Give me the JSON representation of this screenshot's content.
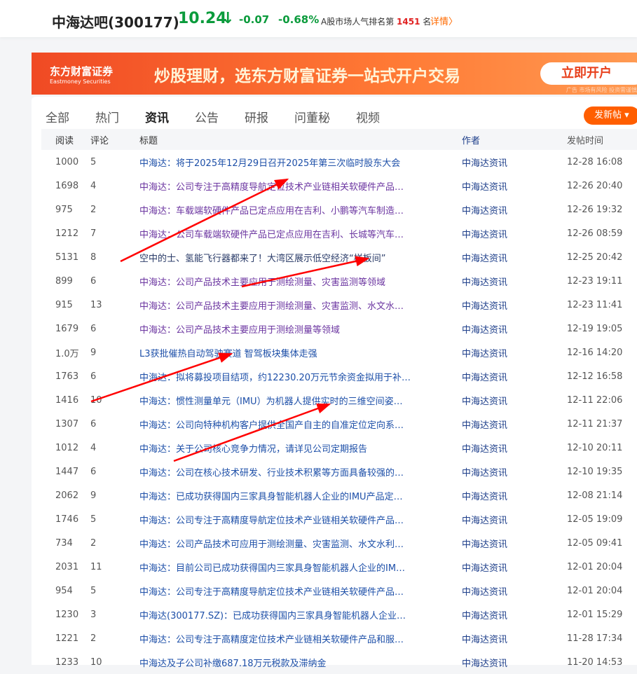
{
  "header": {
    "name": "中海达吧(300177)",
    "price": "10.24",
    "arrow": "↓",
    "change": "-0.07",
    "pct": "-0.68%",
    "rank_prefix": "A股市场人气排名第",
    "rank": "1451",
    "rank_suffix": "名",
    "detail": "详情〉"
  },
  "banner": {
    "logo": "东方财富证券",
    "logo_en": "Eastmoney Securities",
    "slogan": "炒股理财，选东方财富证券一站式开户交易",
    "cta": "立即开户",
    "ad": "广告 市场有风险 投资需谨慎"
  },
  "tabs": [
    "全部",
    "热门",
    "资讯",
    "公告",
    "研报",
    "问董秘",
    "视频"
  ],
  "active_tab": "资讯",
  "post_button": "发新帖 ▾",
  "columns": [
    "阅读",
    "评论",
    "标题",
    "作者",
    "发帖时间"
  ],
  "rows": [
    [
      "1000",
      "5",
      "中海达：将于2025年12月29日召开2025年第三次临时股东大会",
      "中海达资讯",
      "12-28 16:08",
      ""
    ],
    [
      "1698",
      "4",
      "中海达：公司专注于高精度导航定位技术产业链相关软硬件产品…",
      "中海达资讯",
      "12-26 20:40",
      "visited"
    ],
    [
      "975",
      "2",
      "中海达：车载端软硬件产品已定点应用在吉利、小鹏等汽车制造…",
      "中海达资讯",
      "12-26 19:32",
      "visited"
    ],
    [
      "1212",
      "7",
      "中海达：公司车载端软硬件产品已定点应用在吉利、长城等汽车…",
      "中海达资讯",
      "12-26 08:59",
      "visited"
    ],
    [
      "5131",
      "8",
      "空中的士、氢能飞行器都来了！大湾区展示低空经济“样板间”",
      "中海达资讯",
      "12-25 20:42",
      "plain"
    ],
    [
      "899",
      "6",
      "中海达：公司产品技术主要应用于测绘测量、灾害监测等领域",
      "中海达资讯",
      "12-23 19:11",
      "visited"
    ],
    [
      "915",
      "13",
      "中海达：公司产品技术主要应用于测绘测量、灾害监测、水文水…",
      "中海达资讯",
      "12-23 11:41",
      "visited"
    ],
    [
      "1679",
      "6",
      "中海达：公司产品技术主要应用于测绘测量等领域",
      "中海达资讯",
      "12-19 19:05",
      "visited"
    ],
    [
      "1.0万",
      "9",
      "L3获批催热自动驾驶赛道 智驾板块集体走强",
      "中海达资讯",
      "12-16 14:20",
      ""
    ],
    [
      "1763",
      "6",
      "中海达：拟将募投项目结项，约12230.20万元节余资金拟用于补…",
      "中海达资讯",
      "12-12 16:58",
      ""
    ],
    [
      "1416",
      "10",
      "中海达：惯性测量单元（IMU）为机器人提供实时的三维空间姿…",
      "中海达资讯",
      "12-11 22:06",
      ""
    ],
    [
      "1307",
      "6",
      "中海达：公司向特种机构客户提供全国产自主的自准定位定向系…",
      "中海达资讯",
      "12-11 21:37",
      ""
    ],
    [
      "1012",
      "4",
      "中海达：关于公司核心竞争力情况，请详见公司定期报告",
      "中海达资讯",
      "12-10 20:11",
      ""
    ],
    [
      "1447",
      "6",
      "中海达：公司在核心技术研发、行业技术积累等方面具备较强的…",
      "中海达资讯",
      "12-10 19:35",
      ""
    ],
    [
      "2062",
      "9",
      "中海达：已成功获得国内三家具身智能机器人企业的IMU产品定…",
      "中海达资讯",
      "12-08 21:14",
      ""
    ],
    [
      "1746",
      "5",
      "中海达：公司专注于高精度导航定位技术产业链相关软硬件产品…",
      "中海达资讯",
      "12-05 19:09",
      ""
    ],
    [
      "734",
      "2",
      "中海达：公司产品技术可应用于测绘测量、灾害监测、水文水利…",
      "中海达资讯",
      "12-05 09:41",
      ""
    ],
    [
      "2031",
      "11",
      "中海达：目前公司已成功获得国内三家具身智能机器人企业的IM…",
      "中海达资讯",
      "12-01 20:04",
      ""
    ],
    [
      "954",
      "5",
      "中海达：公司专注于高精度导航定位技术产业链相关软硬件产品…",
      "中海达资讯",
      "12-01 20:04",
      ""
    ],
    [
      "1230",
      "3",
      "中海达(300177.SZ)：已成功获得国内三家具身智能机器人企业…",
      "中海达资讯",
      "12-01 15:29",
      ""
    ],
    [
      "1221",
      "2",
      "中海达：公司专注于高精度定位技术产业链相关软硬件产品和服…",
      "中海达资讯",
      "11-28 17:34",
      ""
    ],
    [
      "1233",
      "10",
      "中海达及子公司补缴687.18万元税款及滞纳金",
      "中海达资讯",
      "11-20 14:53",
      ""
    ]
  ],
  "colors": {
    "accent": "#ff5e00",
    "down": "#0b9b3c",
    "link": "#1d4fa8",
    "visited": "#6b35a0",
    "annotation": "#ff0000"
  }
}
